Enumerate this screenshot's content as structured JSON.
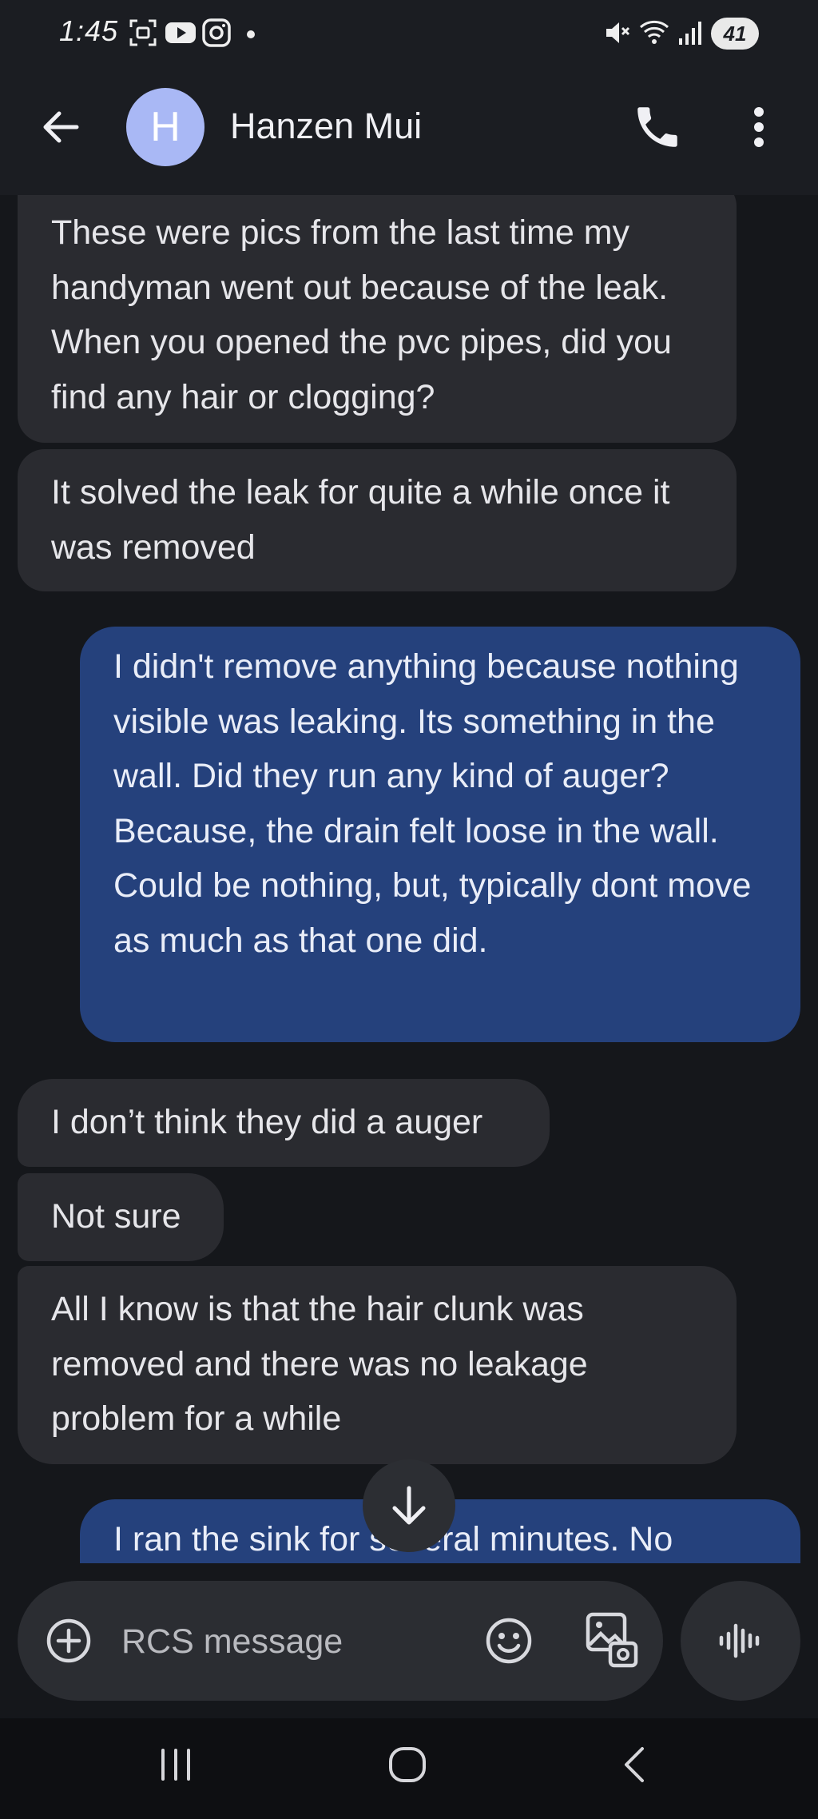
{
  "status_bar": {
    "time": "1:45",
    "battery": "41",
    "icons": [
      "screenshot-icon",
      "youtube-icon",
      "instagram-icon",
      "notification-dot-icon",
      "mute-icon",
      "wifi-icon",
      "signal-icon",
      "battery-icon"
    ]
  },
  "header": {
    "avatar_letter": "H",
    "contact_name": "Hanzen Mui",
    "icons": [
      "back-arrow-icon",
      "phone-icon",
      "more-vert-icon"
    ]
  },
  "messages": [
    {
      "direction": "in",
      "text": "These were pics from the last time my handyman went out because of the leak. When you opened the pvc pipes, did you find any hair or clogging?"
    },
    {
      "direction": "in",
      "text": "It solved the leak for quite a while once it was removed"
    },
    {
      "direction": "out",
      "text": "I didn't remove anything because nothing visible was leaking. Its something in the wall. Did they run any kind of auger? Because, the drain felt loose in the wall. Could be nothing, but, typically dont move as much as that one did."
    },
    {
      "direction": "in",
      "text": "I don’t think they did a auger"
    },
    {
      "direction": "in",
      "text": "Not sure"
    },
    {
      "direction": "in",
      "text": "All I know is that the hair clunk was removed and there was no leakage problem for a while"
    },
    {
      "direction": "out",
      "text": "I ran the sink for several minutes. No"
    }
  ],
  "compose": {
    "placeholder": "RCS message",
    "icons": [
      "add-circle-icon",
      "emoji-icon",
      "gallery-icon",
      "voice-waveform-icon"
    ]
  },
  "colors": {
    "background": "#15171b",
    "incoming_bubble": "#2a2b30",
    "outgoing_bubble": "#25417c",
    "avatar": "#a9b8f5"
  }
}
